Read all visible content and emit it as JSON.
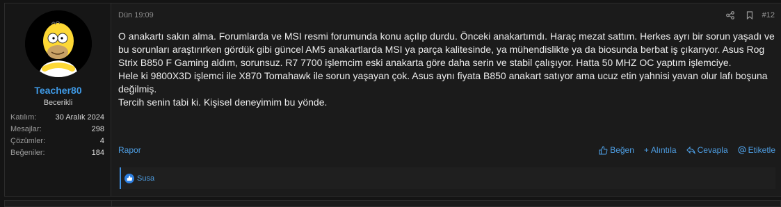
{
  "post": {
    "user": {
      "name": "Teacher80",
      "title": "Becerikli",
      "avatar_icon": "homer-simpson-avatar",
      "stats": [
        {
          "label": "Katılım:",
          "value": "30 Aralık 2024"
        },
        {
          "label": "Mesajlar:",
          "value": "298"
        },
        {
          "label": "Çözümler:",
          "value": "4"
        },
        {
          "label": "Beğeniler:",
          "value": "184"
        }
      ]
    },
    "date": "Dün 19:09",
    "number": "#12",
    "body": [
      "O anakartı sakın alma. Forumlarda ve MSI resmi forumunda konu açılıp durdu. Önceki anakartımdı. Haraç mezat sattım. Herkes ayrı bir sorun yaşadı ve bu sorunları araştırırken gördük gibi güncel AM5 anakartlarda MSI ya parça kalitesinde, ya mühendislikte ya da biosunda berbat iş çıkarıyor. Asus Rog Strix B850 F Gaming aldım, sorunsuz. R7 7700 işlemcim eski anakarta göre daha serin ve stabil çalışıyor. Hatta 50 MHZ OC yaptım işlemciye.",
      "Hele ki 9800X3D işlemci ile X870 Tomahawk ile sorun yaşayan çok. Asus aynı fiyata B850 anakart satıyor ama ucuz etin yahnisi yavan olur lafı boşuna değilmiş.",
      "Tercih senin tabi ki. Kişisel deneyimim bu yönde."
    ],
    "report_label": "Rapor",
    "actions": {
      "like": "Beğen",
      "quote": "Alıntıla",
      "reply": "Cevapla",
      "tag": "Etiketle"
    },
    "reactions": {
      "users": "Susa"
    }
  },
  "colors": {
    "accent": "#4e9ee3",
    "background": "#1b1b1b",
    "username": "#3f9ae6"
  }
}
